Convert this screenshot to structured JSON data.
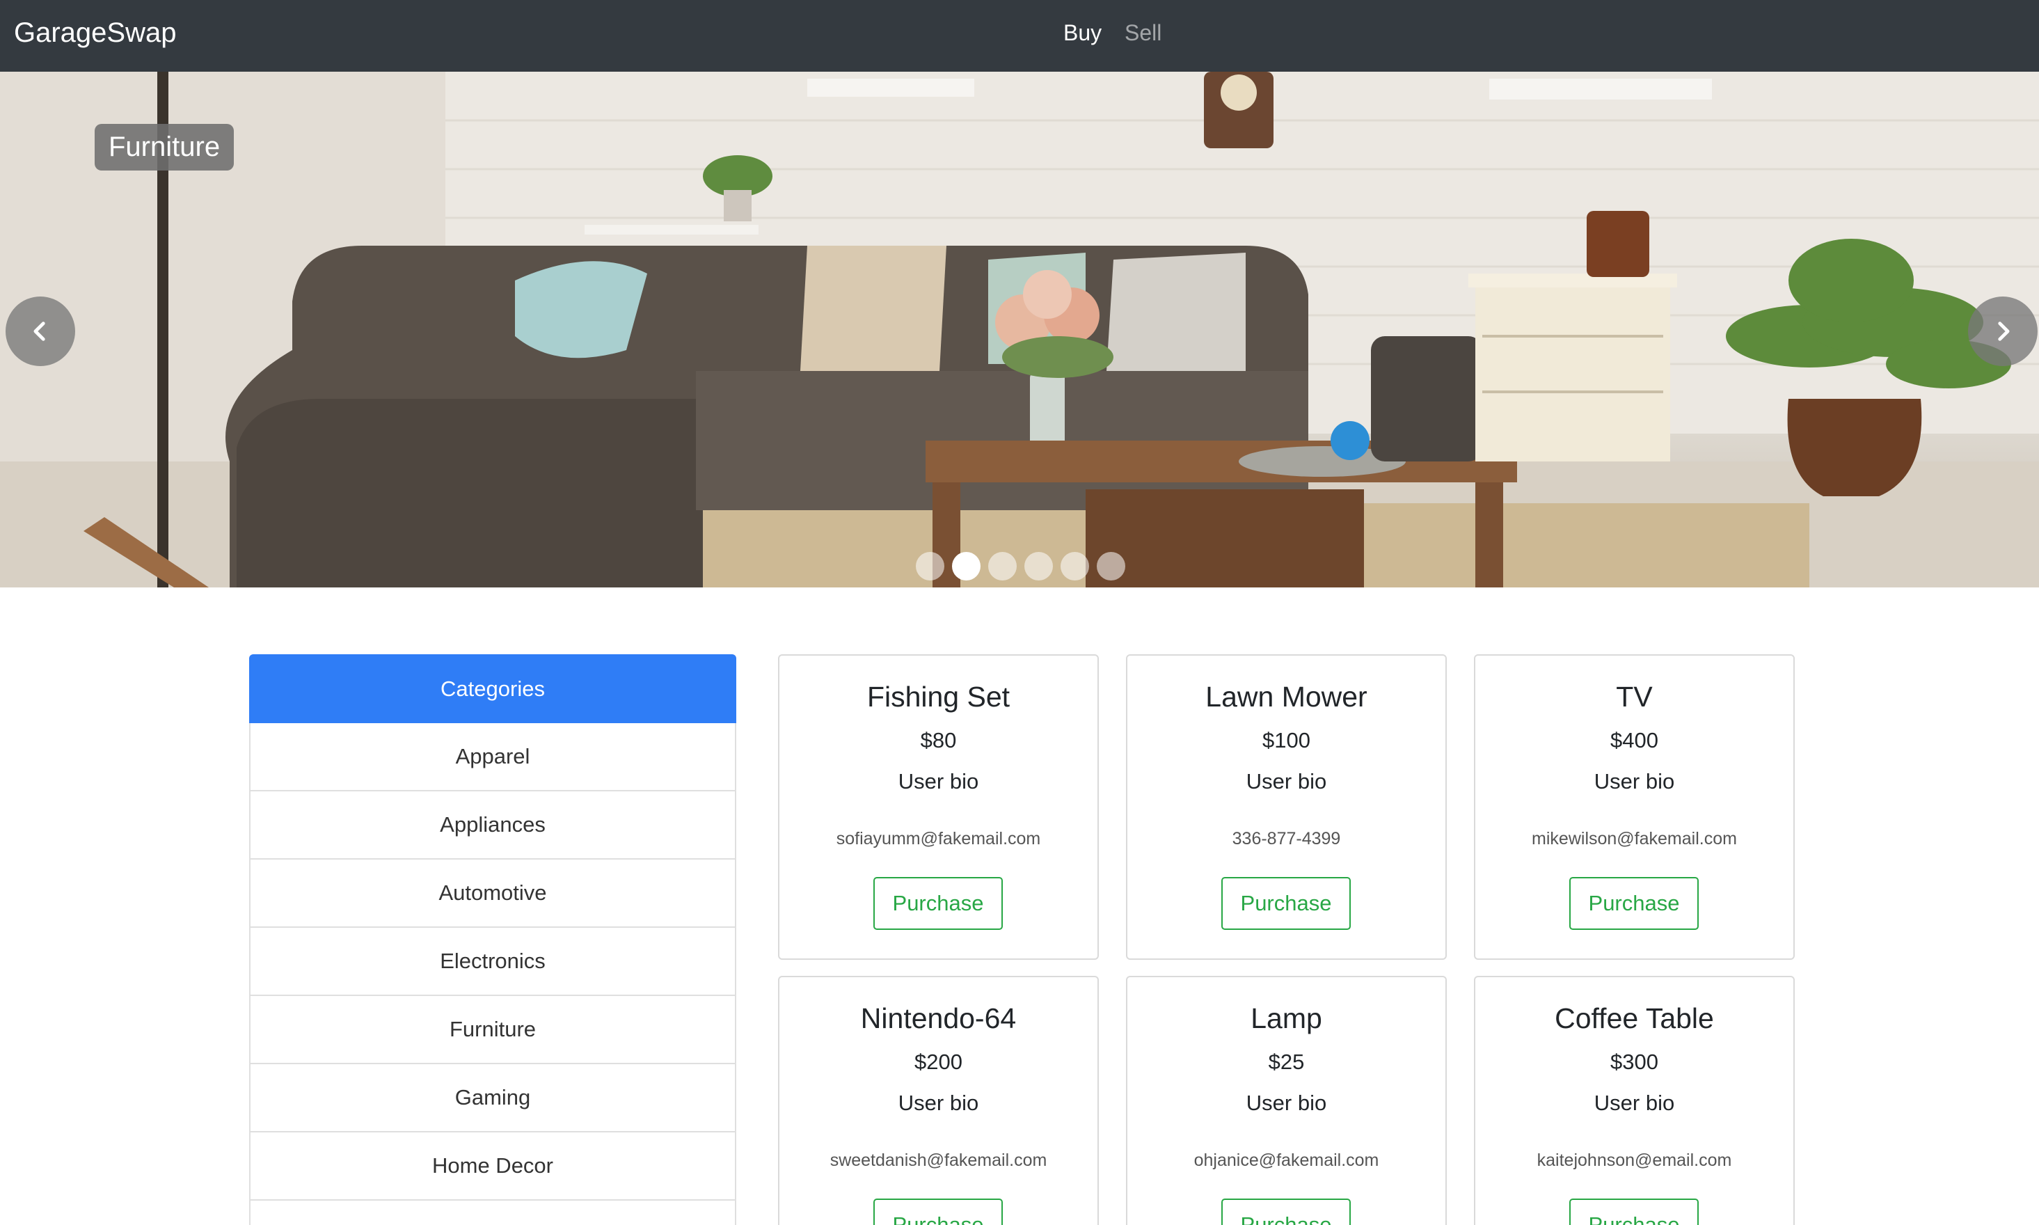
{
  "navbar": {
    "brand": "GarageSwap",
    "links": [
      {
        "label": "Buy",
        "active": true
      },
      {
        "label": "Sell",
        "active": false
      }
    ]
  },
  "carousel": {
    "caption": "Furniture",
    "slide_count": 6,
    "active_index": 1,
    "prev_icon": "chevron-left-icon",
    "next_icon": "chevron-right-icon"
  },
  "categories": {
    "header": "Categories",
    "items": [
      "Apparel",
      "Appliances",
      "Automotive",
      "Electronics",
      "Furniture",
      "Gaming",
      "Home Decor"
    ]
  },
  "products": [
    {
      "name": "Fishing Set",
      "price": "$80",
      "bio": "User bio",
      "contact": "sofiayumm@fakemail.com",
      "button": "Purchase"
    },
    {
      "name": "Lawn Mower",
      "price": "$100",
      "bio": "User bio",
      "contact": "336-877-4399",
      "button": "Purchase"
    },
    {
      "name": "TV",
      "price": "$400",
      "bio": "User bio",
      "contact": "mikewilson@fakemail.com",
      "button": "Purchase"
    },
    {
      "name": "Nintendo-64",
      "price": "$200",
      "bio": "User bio",
      "contact": "sweetdanish@fakemail.com",
      "button": "Purchase"
    },
    {
      "name": "Lamp",
      "price": "$25",
      "bio": "User bio",
      "contact": "ohjanice@fakemail.com",
      "button": "Purchase"
    },
    {
      "name": "Coffee Table",
      "price": "$300",
      "bio": "User bio",
      "contact": "kaitejohnson@email.com",
      "button": "Purchase"
    }
  ],
  "colors": {
    "navbar_bg": "#343a40",
    "primary": "#2f7df6",
    "success": "#28a745"
  }
}
